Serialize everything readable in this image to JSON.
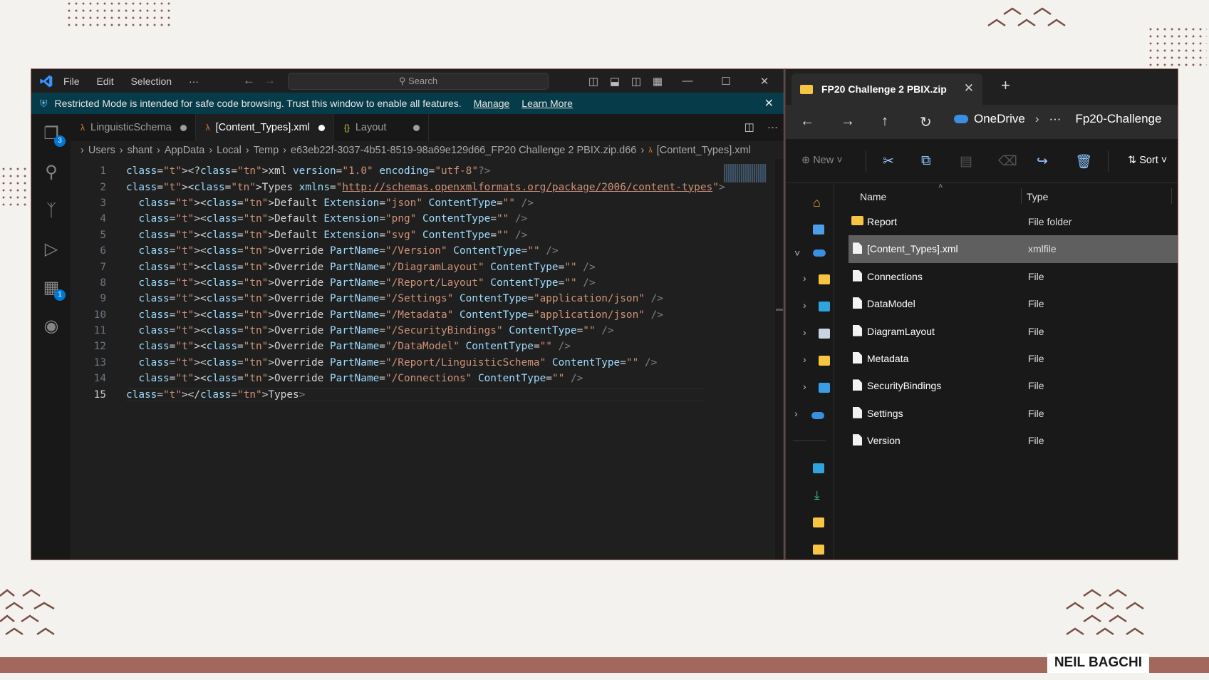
{
  "vscode": {
    "menu": [
      "File",
      "Edit",
      "Selection",
      "···"
    ],
    "search_placeholder": "Search",
    "banner": {
      "message": "Restricted Mode is intended for safe code browsing. Trust this window to enable all features.",
      "manage": "Manage",
      "learn_more": "Learn More"
    },
    "activity_badges": {
      "explorer": "3",
      "extensions": "1"
    },
    "tabs": [
      {
        "label": "LinguisticSchema",
        "icon": "xml-icon"
      },
      {
        "label": "[Content_Types].xml",
        "icon": "xml-icon"
      },
      {
        "label": "Layout",
        "icon": "json-braces-icon"
      }
    ],
    "breadcrumb": [
      "Users",
      "shant",
      "AppData",
      "Local",
      "Temp",
      "e63eb22f-3037-4b51-8519-98a69e129d66_FP20 Challenge 2 PBIX.zip.d66",
      "[Content_Types].xml"
    ],
    "code": [
      "<?xml version=\"1.0\" encoding=\"utf-8\"?>",
      "<Types xmlns=\"http://schemas.openxmlformats.org/package/2006/content-types\">",
      "  <Default Extension=\"json\" ContentType=\"\" />",
      "  <Default Extension=\"png\" ContentType=\"\" />",
      "  <Default Extension=\"svg\" ContentType=\"\" />",
      "  <Override PartName=\"/Version\" ContentType=\"\" />",
      "  <Override PartName=\"/DiagramLayout\" ContentType=\"\" />",
      "  <Override PartName=\"/Report/Layout\" ContentType=\"\" />",
      "  <Override PartName=\"/Settings\" ContentType=\"application/json\" />",
      "  <Override PartName=\"/Metadata\" ContentType=\"application/json\" />",
      "  <Override PartName=\"/SecurityBindings\" ContentType=\"\" />",
      "  <Override PartName=\"/DataModel\" ContentType=\"\" />",
      "  <Override PartName=\"/Report/LinguisticSchema\" ContentType=\"\" />",
      "  <Override PartName=\"/Connections\" ContentType=\"\" />",
      "</Types>"
    ],
    "current_line": 15
  },
  "explorer": {
    "tab_title": "FP20 Challenge 2 PBIX.zip",
    "path": [
      "OneDrive",
      "···",
      "Fp20-Challenge"
    ],
    "toolbar": {
      "new": "New",
      "sort": "Sort"
    },
    "columns": {
      "name": "Name",
      "type": "Type"
    },
    "files": [
      {
        "name": "Report",
        "type": "File folder",
        "kind": "folder"
      },
      {
        "name": "[Content_Types].xml",
        "type": "xmlfile",
        "kind": "file"
      },
      {
        "name": "Connections",
        "type": "File",
        "kind": "file"
      },
      {
        "name": "DataModel",
        "type": "File",
        "kind": "file"
      },
      {
        "name": "DiagramLayout",
        "type": "File",
        "kind": "file"
      },
      {
        "name": "Metadata",
        "type": "File",
        "kind": "file"
      },
      {
        "name": "SecurityBindings",
        "type": "File",
        "kind": "file"
      },
      {
        "name": "Settings",
        "type": "File",
        "kind": "file"
      },
      {
        "name": "Version",
        "type": "File",
        "kind": "file"
      }
    ]
  },
  "brand": "NEIL BAGCHI",
  "colors": {
    "accent": "#a2685c",
    "vscode_blue": "#3794ff",
    "banner": "#063b49"
  }
}
